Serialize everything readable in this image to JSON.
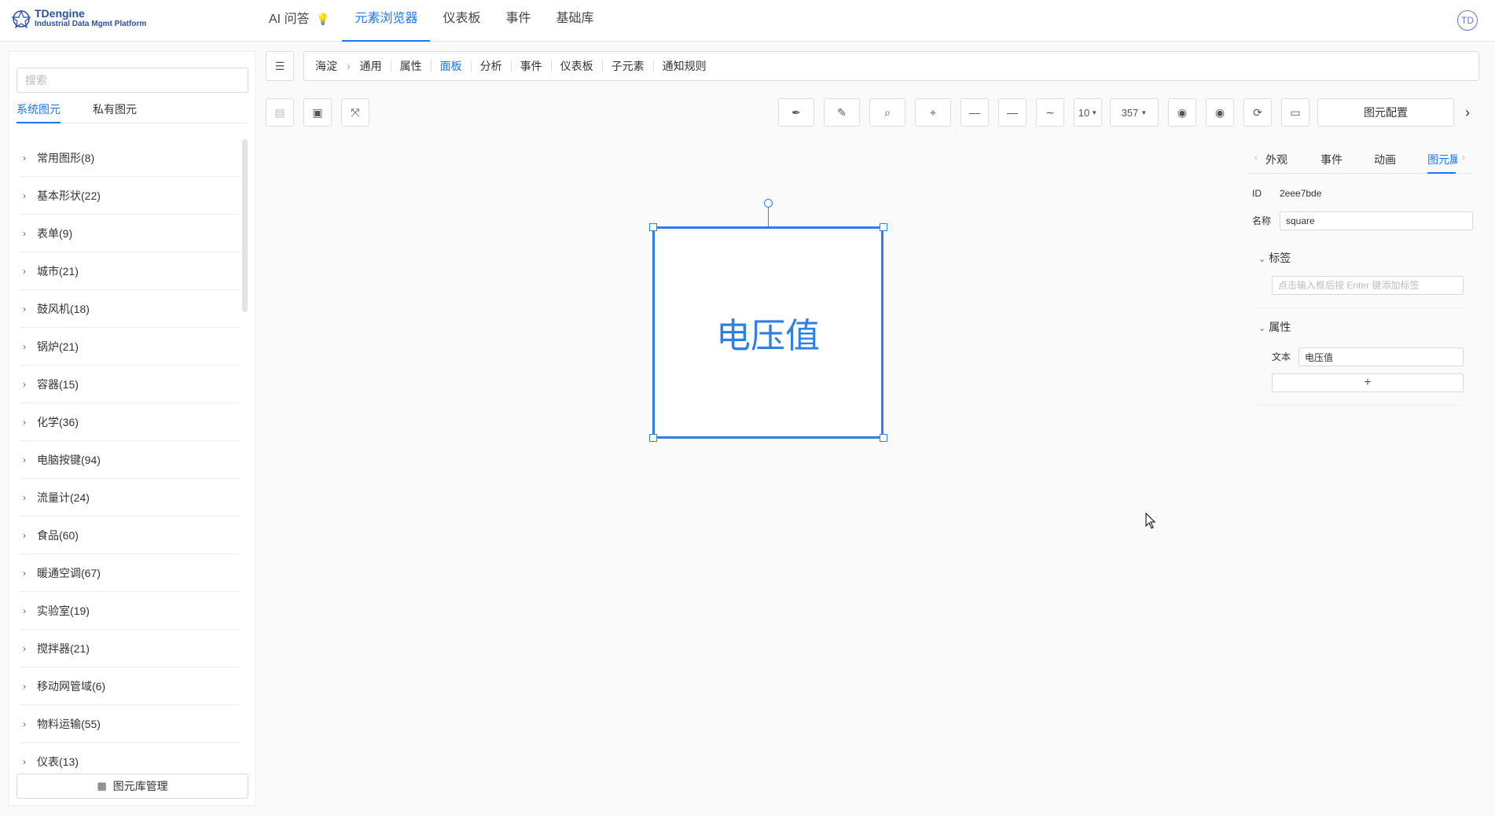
{
  "brand": {
    "name": "TDengine",
    "subtitle": "Industrial Data Mgmt Platform"
  },
  "nav": {
    "items": [
      {
        "label": "AI 问答"
      },
      {
        "label": "元素浏览器"
      },
      {
        "label": "仪表板"
      },
      {
        "label": "事件"
      },
      {
        "label": "基础库"
      }
    ],
    "active": "元素浏览器"
  },
  "user": {
    "initials": "TD"
  },
  "left_panel": {
    "search_placeholder": "搜索",
    "tabs": [
      {
        "label": "系统图元"
      },
      {
        "label": "私有图元"
      }
    ],
    "active_tab": "系统图元",
    "categories": [
      {
        "label": "常用图形(8)"
      },
      {
        "label": "基本形状(22)"
      },
      {
        "label": "表单(9)"
      },
      {
        "label": "城市(21)"
      },
      {
        "label": "鼓风机(18)"
      },
      {
        "label": "锅炉(21)"
      },
      {
        "label": "容器(15)"
      },
      {
        "label": "化学(36)"
      },
      {
        "label": "电脑按键(94)"
      },
      {
        "label": "流量计(24)"
      },
      {
        "label": "食品(60)"
      },
      {
        "label": "暖通空调(67)"
      },
      {
        "label": "实验室(19)"
      },
      {
        "label": "搅拌器(21)"
      },
      {
        "label": "移动网管域(6)"
      },
      {
        "label": "物料运输(55)"
      },
      {
        "label": "仪表(13)"
      }
    ],
    "library_button": "图元库管理"
  },
  "breadcrumb": {
    "root": "海淀",
    "items": [
      {
        "label": "通用"
      },
      {
        "label": "属性"
      },
      {
        "label": "面板"
      },
      {
        "label": "分析"
      },
      {
        "label": "事件"
      },
      {
        "label": "仪表板"
      },
      {
        "label": "子元素"
      },
      {
        "label": "通知规则"
      }
    ],
    "active": "面板"
  },
  "toolbar": {
    "stroke_width": "10",
    "color_value": "357",
    "config_button": "图元配置"
  },
  "canvas": {
    "shape_text": "电压值"
  },
  "right_panel": {
    "tabs": [
      {
        "label": "外观"
      },
      {
        "label": "事件"
      },
      {
        "label": "动画"
      },
      {
        "label": "图元属"
      }
    ],
    "active_tab": "图元属",
    "id_label": "ID",
    "id_value": "2eee7bde",
    "name_label": "名称",
    "name_value": "square",
    "tags_section": "标签",
    "tags_placeholder": "点击输入框后按 Enter 键添加标签",
    "props_section": "属性",
    "text_label": "文本",
    "text_value": "电压值",
    "add_label": "+"
  },
  "colors": {
    "accent": "#1677ff",
    "shape_stroke": "#2f80e6"
  }
}
